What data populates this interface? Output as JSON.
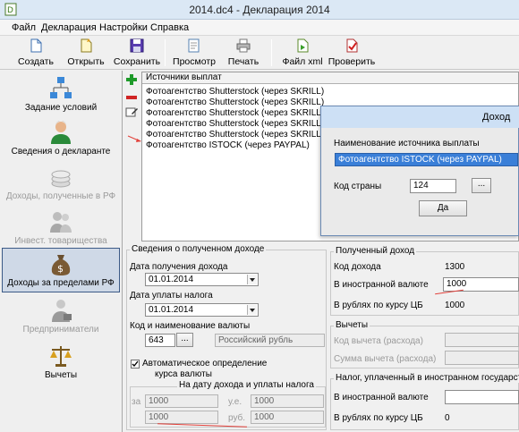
{
  "window": {
    "title": "2014.dc4 - Декларация 2014"
  },
  "menu": [
    "Файл",
    "Декларация",
    "Настройки",
    "Справка"
  ],
  "toolbar": {
    "create": "Создать",
    "open": "Открыть",
    "save": "Сохранить",
    "preview": "Просмотр",
    "print": "Печать",
    "xml": "Файл xml",
    "check": "Проверить"
  },
  "nav": [
    {
      "label": "Задание условий",
      "icon": "conditions-tree-icon",
      "state": "normal"
    },
    {
      "label": "Сведения о декларанте",
      "icon": "person-icon",
      "state": "normal"
    },
    {
      "label": "Доходы, полученные в РФ",
      "icon": "coins-icon",
      "state": "disabled"
    },
    {
      "label": "Инвест. товарищества",
      "icon": "investors-icon",
      "state": "disabled"
    },
    {
      "label": "Доходы за пределами РФ",
      "icon": "money-bag-icon",
      "state": "active"
    },
    {
      "label": "Предприниматели",
      "icon": "businessman-icon",
      "state": "disabled"
    },
    {
      "label": "Вычеты",
      "icon": "scales-icon",
      "state": "normal"
    }
  ],
  "sources": {
    "header": "Источники выплат",
    "rows": [
      "Фотоагентство Shutterstock (через SKRILL)",
      "Фотоагентство Shutterstock (через SKRILL)",
      "Фотоагентство Shutterstock (через SKRILL)",
      "Фотоагентство Shutterstock (через SKRILL)",
      "Фотоагентство Shutterstock (через SKRILL)",
      "Фотоагентство ISTOCK (через PAYPAL)"
    ]
  },
  "dialog": {
    "title": "Доход",
    "name_label": "Наименование источника выплаты",
    "name_value": "Фотоагентство ISTOCK (через PAYPAL)",
    "country_label": "Код страны",
    "country_value": "124",
    "browse": "...",
    "ok": "Да"
  },
  "received": {
    "title": "Сведения о полученном доходе",
    "date_label": "Дата получения дохода",
    "date_value": "01.01.2014",
    "tax_date_label": "Дата уплаты налога",
    "tax_date_value": "01.01.2014",
    "currency_label": "Код и наименование валюты",
    "currency_code": "643",
    "currency_browse": "...",
    "currency_name": "Российский рубль",
    "auto_label": "Автоматическое определение",
    "auto_label2": "курса валюты",
    "rate_dates_label": "На дату дохода и уплаты налога",
    "za_label": "за",
    "rate1": "1000",
    "rate2": "1000",
    "ue_label": "у.е.",
    "rub_label": "руб.",
    "rate3": "1000",
    "rate4": "1000"
  },
  "income": {
    "title": "Полученный доход",
    "code_label": "Код дохода",
    "code_value": "1300",
    "foreign_label": "В иностранной валюте",
    "foreign_value": "1000",
    "rub_label": "В рублях по курсу ЦБ",
    "rub_value": "1000"
  },
  "deductions": {
    "title": "Вычеты",
    "code_label": "Код вычета (расхода)",
    "sum_label": "Сумма вычета (расхода)"
  },
  "tax": {
    "title": "Налог, уплаченный в иностранном государстве",
    "foreign_label": "В иностранной валюте",
    "rub_label": "В рублях по курсу ЦБ",
    "rub_value": "0"
  }
}
